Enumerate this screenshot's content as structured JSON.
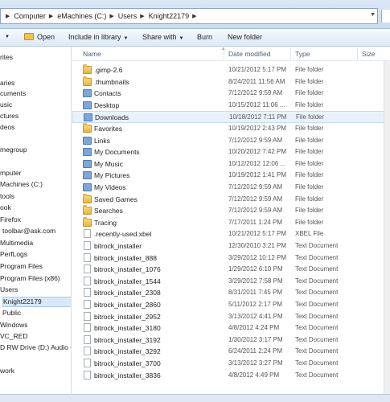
{
  "address": {
    "crumbs": [
      "Computer",
      "eMachines (C:)",
      "Users",
      "Knight22179"
    ]
  },
  "toolbar": {
    "open_label": "Open",
    "include_label": "Include in library",
    "share_label": "Share with",
    "burn_label": "Burn",
    "new_folder_label": "New folder"
  },
  "nav": {
    "items": [
      "rites",
      "",
      "aries",
      "cuments",
      "usic",
      "ctures",
      "deos",
      "",
      "megroup",
      "",
      "mputer",
      "Machines (C:)",
      "tools",
      "ook",
      "Firefox",
      "toolbar@ask.com",
      "Multimedia",
      "PerfLogs",
      "Program Files",
      "Program Files (x86)",
      "Users",
      "Knight22179",
      "Public",
      "Windows",
      "VC_RED",
      "D RW Drive (D:) Audio C",
      "",
      "work"
    ]
  },
  "columns": {
    "name": "Name",
    "date": "Date modified",
    "type": "Type",
    "size": "Size"
  },
  "files": [
    {
      "name": ".gimp-2.6",
      "date": "10/21/2012 5:17 PM",
      "type": "File folder",
      "icon": "folder"
    },
    {
      "name": ".thumbnails",
      "date": "8/24/2011 11:56 AM",
      "type": "File folder",
      "icon": "folder"
    },
    {
      "name": "Contacts",
      "date": "7/12/2012 9:59 AM",
      "type": "File folder",
      "icon": "special"
    },
    {
      "name": "Desktop",
      "date": "10/15/2012 11:06 ...",
      "type": "File folder",
      "icon": "special"
    },
    {
      "name": "Downloads",
      "date": "10/18/2012 7:11 PM",
      "type": "File folder",
      "icon": "special"
    },
    {
      "name": "Favorites",
      "date": "10/19/2012 2:43 PM",
      "type": "File folder",
      "icon": "folder"
    },
    {
      "name": "Links",
      "date": "7/12/2012 9:59 AM",
      "type": "File folder",
      "icon": "special"
    },
    {
      "name": "My Documents",
      "date": "10/20/2012 7:42 PM",
      "type": "File folder",
      "icon": "special"
    },
    {
      "name": "My Music",
      "date": "10/12/2012 12:06 ...",
      "type": "File folder",
      "icon": "special"
    },
    {
      "name": "My Pictures",
      "date": "10/19/2012 1:41 PM",
      "type": "File folder",
      "icon": "special"
    },
    {
      "name": "My Videos",
      "date": "7/12/2012 9:59 AM",
      "type": "File folder",
      "icon": "special"
    },
    {
      "name": "Saved Games",
      "date": "7/12/2012 9:59 AM",
      "type": "File folder",
      "icon": "folder"
    },
    {
      "name": "Searches",
      "date": "7/12/2012 9:59 AM",
      "type": "File folder",
      "icon": "folder"
    },
    {
      "name": "Tracing",
      "date": "7/17/2011 1:24 PM",
      "type": "File folder",
      "icon": "folder"
    },
    {
      "name": ".recently-used.xbel",
      "date": "10/21/2012 5:17 PM",
      "type": "XBEL File",
      "icon": "file"
    },
    {
      "name": "bitrock_installer",
      "date": "12/30/2010 3:21 PM",
      "type": "Text Document",
      "icon": "file"
    },
    {
      "name": "bitrock_installer_888",
      "date": "3/29/2012 10:12 PM",
      "type": "Text Document",
      "icon": "file"
    },
    {
      "name": "bitrock_installer_1076",
      "date": "1/29/2012 6:10 PM",
      "type": "Text Document",
      "icon": "file"
    },
    {
      "name": "bitrock_installer_1544",
      "date": "3/29/2012 7:58 PM",
      "type": "Text Document",
      "icon": "file"
    },
    {
      "name": "bitrock_installer_2308",
      "date": "8/31/2011 7:45 PM",
      "type": "Text Document",
      "icon": "file"
    },
    {
      "name": "bitrock_installer_2860",
      "date": "5/11/2012 2:17 PM",
      "type": "Text Document",
      "icon": "file"
    },
    {
      "name": "bitrock_installer_2952",
      "date": "3/13/2012 4:41 PM",
      "type": "Text Document",
      "icon": "file"
    },
    {
      "name": "bitrock_installer_3180",
      "date": "4/8/2012 4:24 PM",
      "type": "Text Document",
      "icon": "file"
    },
    {
      "name": "bitrock_installer_3192",
      "date": "1/30/2012 3:17 PM",
      "type": "Text Document",
      "icon": "file"
    },
    {
      "name": "bitrock_installer_3292",
      "date": "6/24/2011 2:24 PM",
      "type": "Text Document",
      "icon": "file"
    },
    {
      "name": "bitrock_installer_3700",
      "date": "3/13/2012 3:27 PM",
      "type": "Text Document",
      "icon": "file"
    },
    {
      "name": "bitrock_installer_3836",
      "date": "4/8/2012 4:49 PM",
      "type": "Text Document",
      "icon": "file"
    }
  ],
  "highlighted_index": 4,
  "selected_nav_index": 21
}
